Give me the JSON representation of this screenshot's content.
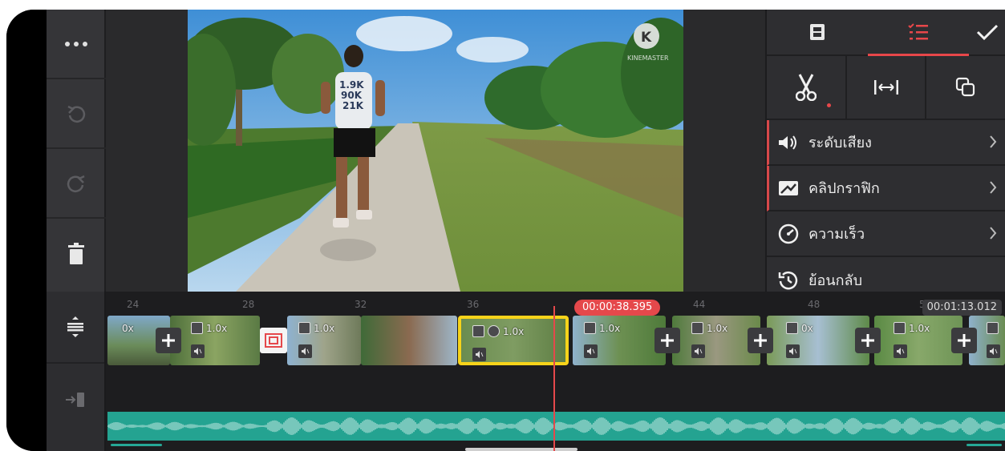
{
  "left_toolbar": {
    "buttons": [
      {
        "name": "more-icon"
      },
      {
        "name": "undo-icon"
      },
      {
        "name": "redo-icon"
      },
      {
        "name": "trash-icon"
      }
    ]
  },
  "preview": {
    "watermark": "KINEMASTER",
    "shirt_text": [
      "1.9K",
      "90K",
      "21K"
    ]
  },
  "right_panel": {
    "tabs": [
      {
        "name": "media-tab",
        "icon": "film-icon",
        "active": false
      },
      {
        "name": "layers-tab",
        "icon": "list-check-icon",
        "active": true
      }
    ],
    "confirm_icon": "checkmark-icon",
    "tools": [
      {
        "name": "trim-split",
        "icon": "scissors-icon"
      },
      {
        "name": "fit-width",
        "icon": "fit-width-icon"
      },
      {
        "name": "pan-zoom",
        "icon": "crop-icon"
      }
    ],
    "menu_items": [
      {
        "label": "ระดับเสียง",
        "icon": "volume-icon"
      },
      {
        "label": "คลิปกราฟิก",
        "icon": "graphic-clip-icon"
      },
      {
        "label": "ความเร็ว",
        "icon": "speed-icon"
      },
      {
        "label": "ย้อนกลับ",
        "icon": "reverse-icon"
      }
    ]
  },
  "timeline": {
    "current_time": "00:00:38.395",
    "total_time": "00:01:13.012",
    "ruler_labels": [
      "24",
      "28",
      "32",
      "36",
      "44",
      "48",
      "52"
    ],
    "clips": [
      {
        "speed": "0x",
        "selected": false
      },
      {
        "speed": "1.0x",
        "selected": false
      },
      {
        "speed": "1.0x",
        "selected": false
      },
      {
        "speed": "1.0x",
        "selected": true
      },
      {
        "speed": "1.0x",
        "selected": false
      },
      {
        "speed": "1.0x",
        "selected": false
      },
      {
        "speed": "0x",
        "selected": false
      },
      {
        "speed": "1.0x",
        "selected": false
      }
    ],
    "colors": {
      "playhead": "#e5484b",
      "audio": "#24a391",
      "selection": "#f7d31a"
    }
  }
}
